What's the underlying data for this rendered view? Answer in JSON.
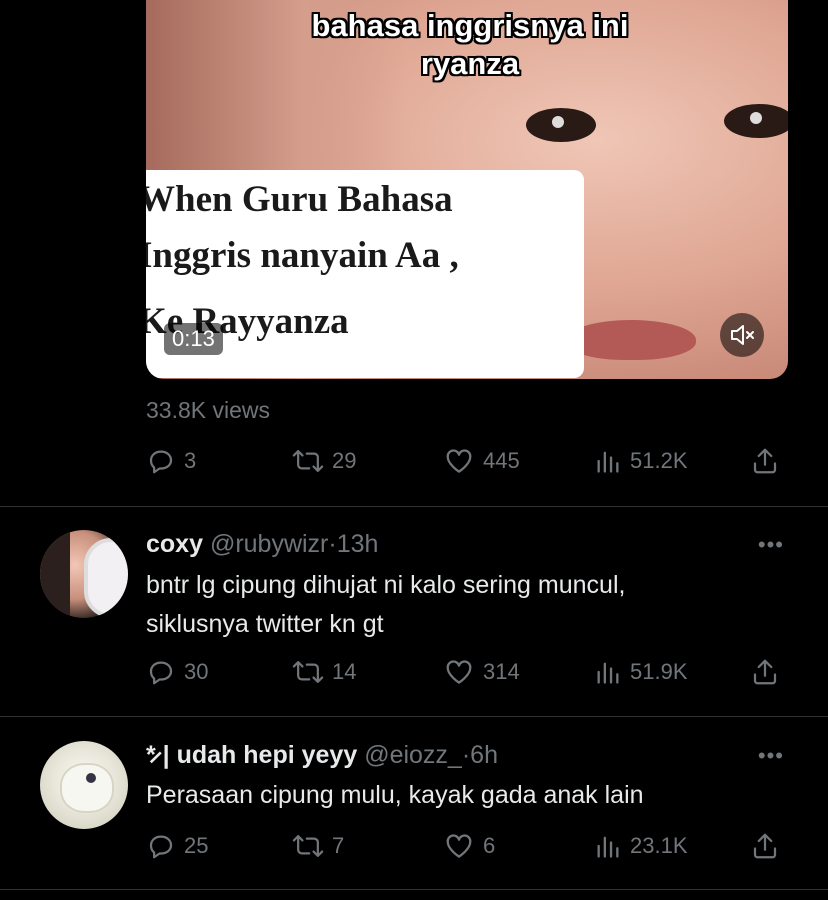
{
  "video": {
    "caption_top": [
      "bahasa inggrisnya ini",
      "ryanza"
    ],
    "caption_box": [
      "When Guru Bahasa",
      "Inggris nanyain Aa ,",
      "Ke Rayyanza"
    ],
    "duration": "0:13",
    "mute_icon": "speaker-muted-icon"
  },
  "main_tweet": {
    "views": "33.8K views",
    "replies": "3",
    "retweets": "29",
    "likes": "445",
    "analytics": "51.2K"
  },
  "replies": [
    {
      "name": "coxy",
      "handle": "@rubywizr",
      "time": "13h",
      "text": [
        "bntr lg cipung dihujat ni kalo sering muncul,",
        "siklusnya twitter kn gt"
      ],
      "replies": "30",
      "retweets": "14",
      "likes": "314",
      "analytics": "51.9K"
    },
    {
      "name": "*̷ | udah hepi yeyy",
      "handle": "@eiozz_",
      "time": "6h",
      "text": [
        "Perasaan cipung mulu, kayak gada anak lain"
      ],
      "replies": "25",
      "retweets": "7",
      "likes": "6",
      "analytics": "23.1K"
    }
  ],
  "more_label": "•••",
  "separator": "·",
  "colors": {
    "background": "#000000",
    "text": "#e7e9ea",
    "muted": "#71767b",
    "divider": "#2f3336"
  }
}
